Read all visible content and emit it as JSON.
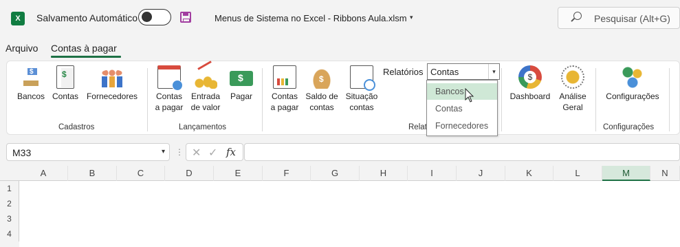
{
  "titlebar": {
    "app_icon": "X",
    "autosave_label": "Salvamento Automático",
    "autosave_state": "",
    "document_title": "Menus de Sistema no Excel - Ribbons Aula.xlsm",
    "search_placeholder": "Pesquisar (Alt+G)"
  },
  "menu": {
    "tabs": [
      "Arquivo",
      "Contas à pagar"
    ],
    "active_tab": "Contas à pagar"
  },
  "ribbon": {
    "groups": {
      "cadastros": "Cadastros",
      "lancamentos": "Lançamentos",
      "relatorios": "Relat",
      "configuracoes": "Configurações"
    },
    "buttons": {
      "bancos": "Bancos",
      "contas": "Contas",
      "fornecedores": "Fornecedores",
      "contas_a_pagar_1": "Contas",
      "contas_a_pagar_2": "a pagar",
      "entrada_valor_1": "Entrada",
      "entrada_valor_2": "de valor",
      "pagar": "Pagar",
      "rel_contas_1": "Contas",
      "rel_contas_2": "a pagar",
      "saldo_1": "Saldo de",
      "saldo_2": "contas",
      "situacao_1": "Situação",
      "situacao_2": "contas",
      "dashboard": "Dashboard",
      "analise_1": "Análise",
      "analise_2": "Geral",
      "configuracoes": "Configurações"
    },
    "relatorios_label": "Relatórios",
    "relatorios_value": "Contas",
    "relatorios_options": [
      "Bancos",
      "Contas",
      "Fornecedores"
    ],
    "relatorios_highlighted": "Bancos"
  },
  "formula_bar": {
    "name_box": "M33",
    "fx": "fx",
    "formula": ""
  },
  "grid": {
    "columns": [
      "A",
      "B",
      "C",
      "D",
      "E",
      "F",
      "G",
      "H",
      "I",
      "J",
      "K",
      "L",
      "M",
      "N"
    ],
    "active_column": "M",
    "rows": [
      "1",
      "2",
      "3",
      "4"
    ]
  },
  "colors": {
    "accent": "#1e7145",
    "highlight": "#cfe8d6"
  }
}
